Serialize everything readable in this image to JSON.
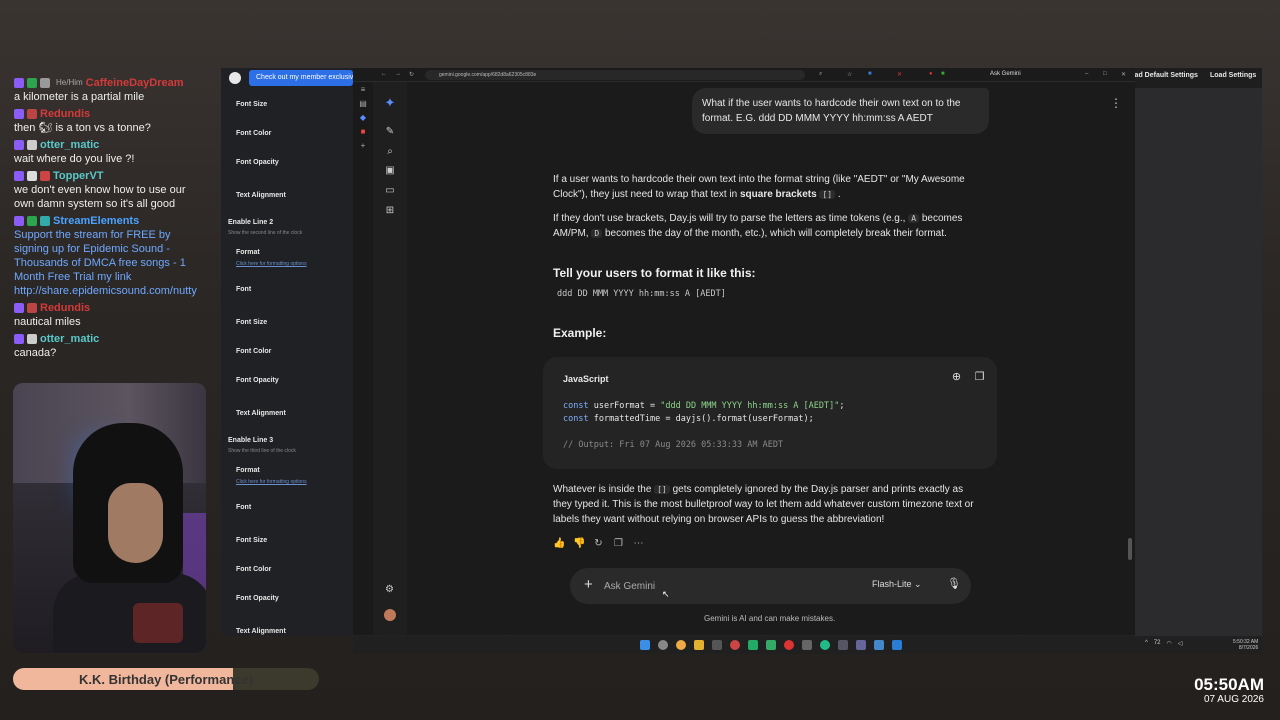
{
  "chat": [
    {
      "user": "CaffeineDayDream",
      "color": "#d43a3a",
      "pronouns": "He/Him",
      "text": "a kilometer is a partial mile",
      "badges": [
        "#8b5cf6",
        "#2da44e",
        "#999"
      ]
    },
    {
      "user": "Redundis",
      "color": "#d43a3a",
      "pronouns": "",
      "text": "then 🐿 is a ton vs a tonne?",
      "badges": [
        "#8b5cf6",
        "#b44"
      ]
    },
    {
      "user": "otter_matic",
      "color": "#5ac8c8",
      "pronouns": "",
      "text": "wait where do you live ?!",
      "badges": [
        "#8b5cf6",
        "#ccc"
      ]
    },
    {
      "user": "TopperVT",
      "color": "#5ac8c8",
      "pronouns": "",
      "text": "we don't even know how to use our own damn system so it's all good",
      "badges": [
        "#8b5cf6",
        "#ddd",
        "#c44"
      ]
    },
    {
      "user": "StreamElements",
      "color": "#4aa3ff",
      "pronouns": "",
      "text": "Support the stream for FREE by signing up for Epidemic Sound - Thousands of DMCA free songs - 1 Month Free Trial my link http://share.epidemicsound.com/nutty",
      "badges": [
        "#8b5cf6",
        "#2da44e",
        "#3aa"
      ],
      "textColor": "#6fa8ff"
    },
    {
      "user": "Redundis",
      "color": "#d43a3a",
      "pronouns": "",
      "text": "nautical miles",
      "badges": [
        "#8b5cf6",
        "#b44"
      ]
    },
    {
      "user": "otter_matic",
      "color": "#5ac8c8",
      "pronouns": "",
      "text": "canada?",
      "badges": [
        "#8b5cf6",
        "#ccc"
      ]
    }
  ],
  "song": {
    "title": "K.K. Birthday (Performance)",
    "progress": 0.72
  },
  "clock": {
    "time": "05:50AM",
    "date": "07 AUG 2026"
  },
  "promo": "Check out my member exclusive",
  "settings": {
    "font_size": "Font Size",
    "font_color": "Font Color",
    "font_opacity": "Font Opacity",
    "text_alignment": "Text Alignment",
    "enable_line2": "Enable Line 2",
    "line2_sub": "Show the second line of the clock",
    "format": "Format",
    "format_link": "Click here for formatting options",
    "font": "Font",
    "enable_line3": "Enable Line 3",
    "line3_sub": "Show the third line of the clock"
  },
  "right_buttons": {
    "default": "Load Default Settings",
    "load": "Load Settings"
  },
  "browser": {
    "url": "gemini.google.com/app/682d8a62305c883e",
    "ask_gemini": "Ask Gemini"
  },
  "conversation": {
    "user_message": "What if the user wants to hardcode their own text on to the format. E.G. ddd DD MMM YYYY hh:mm:ss A AEDT",
    "p1_a": "If a user wants to hardcode their own text into the format string (like \"AEDT\" or \"My Awesome Clock\"), they just need to wrap that text in ",
    "p1_bold": "square brackets",
    "p1_code": "[]",
    "p2_a": "If they don't use brackets, Day.js will try to parse the letters as time tokens (e.g., ",
    "p2_code1": "A",
    "p2_b": " becomes AM/PM, ",
    "p2_code2": "D",
    "p2_c": " becomes the day of the month, etc.), which will completely break their format.",
    "h_format": "Tell your users to format it like this:",
    "format_string": "ddd DD MMM YYYY hh:mm:ss A [AEDT]",
    "h_example": "Example:",
    "code_lang": "JavaScript",
    "code_line1_kw": "const",
    "code_line1_var": " userFormat = ",
    "code_line1_str": "\"ddd DD MMM YYYY hh:mm:ss A [AEDT]\"",
    "code_line1_end": ";",
    "code_line2_kw": "const",
    "code_line2_rest": " formattedTime = dayjs().format(userFormat);",
    "code_comment": "// Output: Fri 07 Aug 2026 05:33:33 AM AEDT",
    "p3_a": "Whatever is inside the ",
    "p3_code": "[]",
    "p3_b": " gets completely ignored by the Day.js parser and prints exactly as they typed it. This is the most bulletproof way to let them add whatever custom timezone text or labels they want without relying on browser APIs to guess the abbreviation!",
    "input_placeholder": "Ask Gemini",
    "model": "Flash-Lite",
    "disclaimer": "Gemini is AI and can make mistakes."
  },
  "taskbar": {
    "temp": "72",
    "time": "5:50:32 AM",
    "date": "8/7/2026"
  },
  "colors": {
    "accent": "#2c6fe6",
    "gemini": "#5b8cff",
    "code_string": "#8bd38b",
    "code_keyword": "#7fb1ff"
  }
}
